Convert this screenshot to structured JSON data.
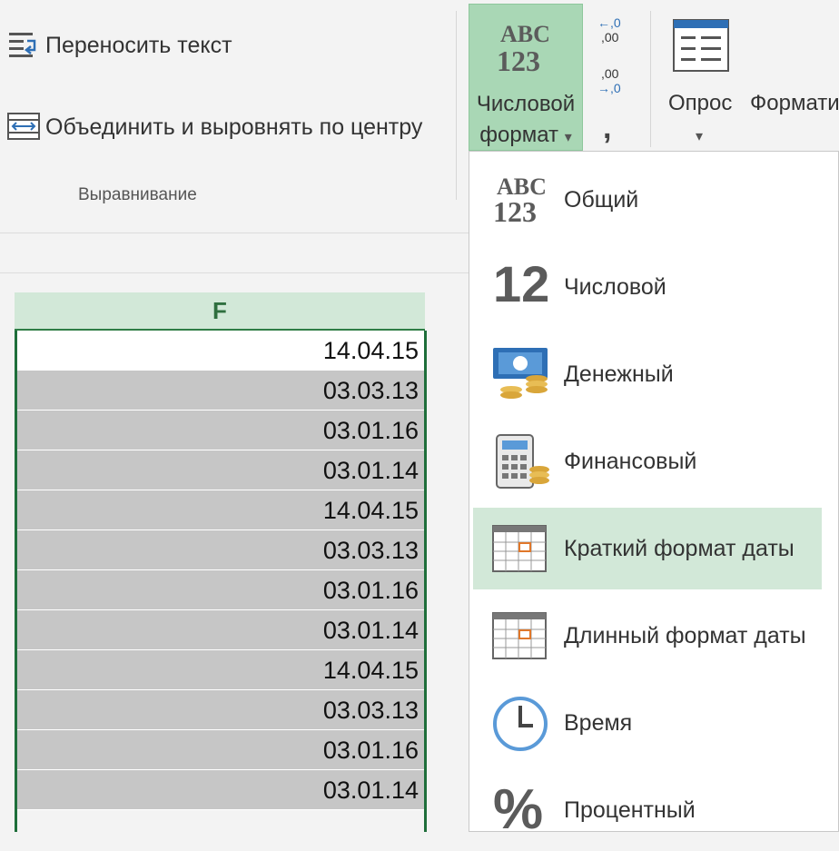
{
  "ribbon": {
    "wrap_text_label": "Переносить текст",
    "merge_center_label": "Объединить и выровнять по центру",
    "alignment_group_label": "Выравнивание",
    "number_format_button": {
      "line1": "Числовой",
      "line2": "формат",
      "caret": "▾"
    },
    "number_format_icon": {
      "top": "ABC",
      "bottom": "123"
    },
    "increase_decimal": {
      "top": "←,0",
      "bottom": ",00"
    },
    "decrease_decimal": {
      "top": ",00",
      "bottom": "→,0"
    },
    "comma_style_label": ",",
    "survey_label": "Опрос",
    "survey_caret": "▾",
    "format_label": "Формати"
  },
  "sheet": {
    "column_header": "F",
    "cells": [
      "14.04.15",
      "03.03.13",
      "03.01.16",
      "03.01.14",
      "14.04.15",
      "03.03.13",
      "03.01.16",
      "03.01.14",
      "14.04.15",
      "03.03.13",
      "03.01.16",
      "03.01.14"
    ]
  },
  "number_format_menu": {
    "items": [
      {
        "label": "Общий",
        "icon": "abc-123-icon",
        "icon_text_top": "ABC",
        "icon_text_bottom": "123"
      },
      {
        "label": "Числовой",
        "icon": "number-12-icon",
        "icon_text": "12"
      },
      {
        "label": "Денежный",
        "icon": "currency-icon"
      },
      {
        "label": "Финансовый",
        "icon": "calculator-icon"
      },
      {
        "label": "Краткий формат даты",
        "icon": "calendar-icon",
        "highlighted": true
      },
      {
        "label": "Длинный формат даты",
        "icon": "calendar-icon"
      },
      {
        "label": "Время",
        "icon": "clock-icon"
      },
      {
        "label": "Процентный",
        "icon": "percent-icon",
        "icon_text": "%"
      }
    ]
  },
  "colors": {
    "accent_green": "#a9d7b5",
    "selection_border": "#1e6e3a",
    "highlight": "#d2e8d8",
    "selected_cell": "#c6c6c6"
  }
}
